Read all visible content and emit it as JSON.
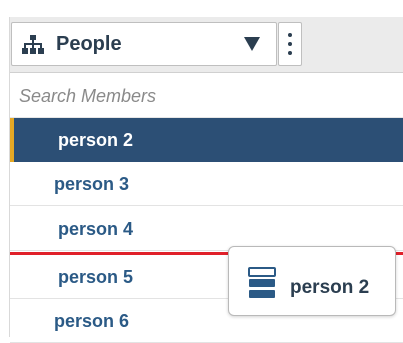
{
  "dropdown": {
    "icon": "people-hierarchy-icon",
    "label": "People",
    "caret_icon": "caret-down-icon",
    "menu_icon": "kebab-menu-icon"
  },
  "search": {
    "placeholder": "Search Members",
    "value": ""
  },
  "members": [
    {
      "label": "person 2",
      "selected": true
    },
    {
      "label": "person 3",
      "selected": false
    },
    {
      "label": "person 4",
      "selected": false
    },
    {
      "label": "person 5",
      "selected": false
    },
    {
      "label": "person 6",
      "selected": false
    }
  ],
  "drag_ghost": {
    "icon": "member-stack-icon",
    "label": "person 2"
  },
  "colors": {
    "header_bg": "#ebebeb",
    "selected_bg": "#2c4f75",
    "selected_accent": "#e5a824",
    "label_blue": "#2b5a86",
    "drop_indicator": "#e0202a"
  }
}
